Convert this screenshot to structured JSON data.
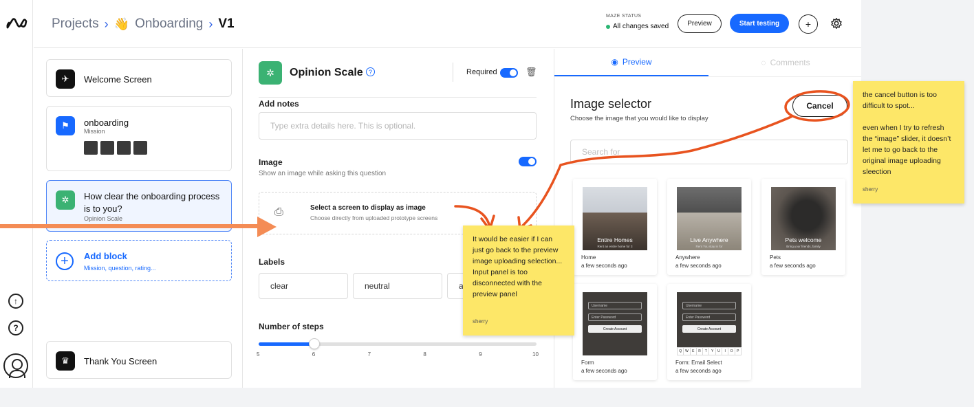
{
  "header": {
    "breadcrumb": [
      "Projects",
      "Onboarding",
      "V1"
    ],
    "status_label": "MAZE STATUS",
    "status_value": "All changes saved",
    "preview_label": "Preview",
    "start_label": "Start testing",
    "plus_label": "+"
  },
  "rail": {
    "upload_icon": "upload-icon",
    "help_icon": "help-icon",
    "avatar_icon": "avatar-icon"
  },
  "blocks": {
    "welcome": "Welcome Screen",
    "onboarding_title": "onboarding",
    "onboarding_sub": "Mission",
    "question_title": "How clear the onboarding process is to you?",
    "question_sub": "Opinion Scale",
    "add_title": "Add block",
    "add_sub": "Mission, question, rating...",
    "thankyou": "Thank You Screen"
  },
  "editor": {
    "title": "Opinion Scale",
    "required_label": "Required",
    "notes_label": "Add notes",
    "notes_placeholder": "Type extra details here. This is optional.",
    "image_label": "Image",
    "image_sub": "Show an image while asking this question",
    "screen_title": "Select a screen to display as image",
    "screen_sub": "Choose directly from uploaded prototype screens",
    "labels_label": "Labels",
    "label_values": [
      "clear",
      "neutral",
      "a"
    ],
    "steps_label": "Number of steps",
    "steps_ticks": [
      "5",
      "6",
      "7",
      "8",
      "9",
      "10"
    ],
    "steps_value": 6,
    "steps_min": 5,
    "steps_max": 10
  },
  "preview": {
    "tab_preview": "Preview",
    "tab_comments": "Comments",
    "title": "Image selector",
    "subtitle": "Choose the image that you would like to display",
    "cancel_label": "Cancel",
    "search_placeholder": "Search for",
    "tiles": [
      {
        "name": "Home",
        "date": "a few seconds ago",
        "caption": "Entire Homes",
        "caption2": "Rent an entire home for 3"
      },
      {
        "name": "Anywhere",
        "date": "a few seconds ago",
        "caption": "Live Anywhere",
        "caption2": "Rent You stay in for"
      },
      {
        "name": "Pets",
        "date": "a few seconds ago",
        "caption": "Pets welcome",
        "caption2": "Bring your friends, family"
      },
      {
        "name": "Form",
        "date": "a few seconds ago",
        "field1": "Username",
        "field2": "Enter Password",
        "button": "Create Account"
      },
      {
        "name": "Form: Email Select",
        "date": "a few seconds ago",
        "field1": "Username",
        "field2": "Enter Password",
        "button": "Create Account",
        "keys": [
          "Q",
          "W",
          "E",
          "R",
          "T",
          "Y",
          "U",
          "I",
          "O",
          "P"
        ]
      }
    ]
  },
  "notes": {
    "left_note": "It would be easier if I can just go back to the preview image uploading selection... Input panel is too disconnected with the preview panel",
    "left_author": "sherry",
    "right_note_1": "the cancel button is too difficult to spot...",
    "right_note_2": "even when I try to refresh the “image” slider, it doesn’t let me to go back to the original image uploading sleection",
    "right_author": "sherry"
  },
  "colors": {
    "accent": "#1769ff",
    "sticky": "#fde768",
    "annotation": "#e8531f",
    "arrow": "#f48c55",
    "success": "#2bb673"
  }
}
